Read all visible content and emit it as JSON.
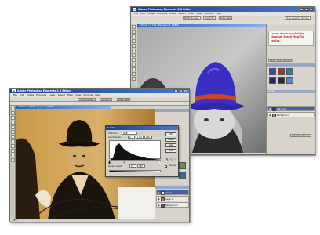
{
  "back_window": {
    "title": "Adobe Photoshop Elements 2.0 Editor",
    "menus": [
      "File",
      "Edit",
      "Image",
      "Enhance",
      "Layer",
      "Select",
      "Filter",
      "View",
      "Window",
      "Help"
    ],
    "toolbar_buttons": [
      "Photo Browser",
      "Quick Fix",
      "Date View"
    ],
    "help_field": "Type question for help",
    "document_title": "Untitled-1 @ 50% (Background, RGB/8)",
    "hint_lines": [
      "Learn more by clicking",
      "through these How To",
      "topics."
    ],
    "styles_palette_label": "Layer Styles & Effects",
    "layers_palette_label": "Layers",
    "layer_names": [
      "Hat Color",
      "Background"
    ],
    "palette_button": "Adjustment Layer",
    "colors": {
      "hat": "#3a2fc2",
      "hat_band": "#c8452a",
      "hint": "#c8302a"
    }
  },
  "front_window": {
    "title": "Adobe Photoshop Elements 2.0 Editor",
    "menus": [
      "File",
      "Edit",
      "Image",
      "Enhance",
      "Layer",
      "Select",
      "Filter",
      "View",
      "Window",
      "Help"
    ],
    "toolbar_buttons": [
      "Photo Browser",
      "Quick Fix",
      "Date View"
    ],
    "document_title": "Untitled-1 @ 50% (Layer 1, RGB/8)",
    "status_text": "50%",
    "layer_names": [
      "Levels 1",
      "Layer 1",
      "Background"
    ],
    "colors": {
      "photo_tone": "#b8873d"
    }
  },
  "levels_dialog": {
    "title": "Levels",
    "channel_label": "Channel:",
    "channel_value": "RGB",
    "input_label": "Input Levels:",
    "input_values": [
      "0",
      "1.00",
      "255"
    ],
    "output_label": "Output Levels:",
    "output_values": [
      "0",
      "255"
    ],
    "buttons": [
      "OK",
      "Reset",
      "Help",
      "Auto"
    ],
    "preview_label": "Preview"
  }
}
